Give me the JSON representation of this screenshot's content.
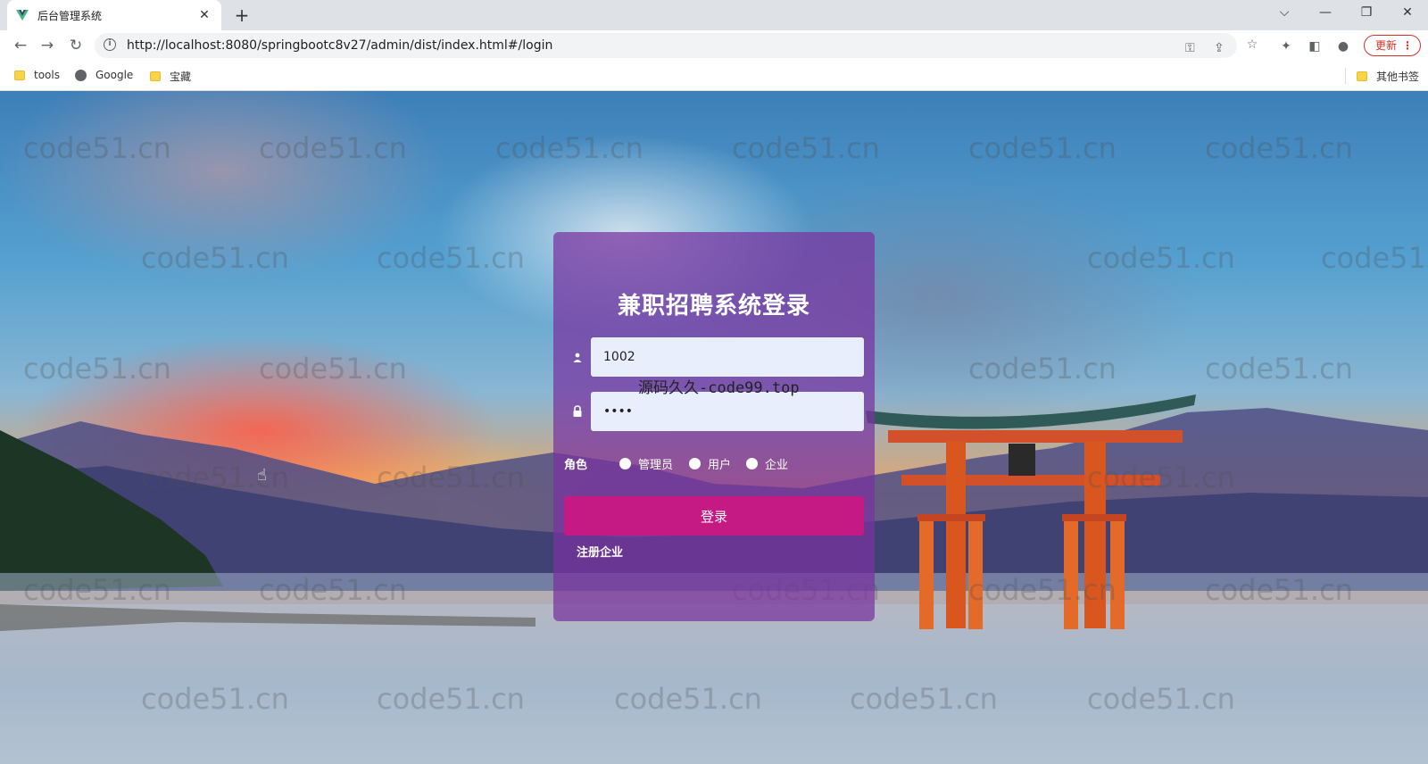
{
  "browser": {
    "tab_title": "后台管理系统",
    "tab_close": "✕",
    "new_tab": "+",
    "url": "http://localhost:8080/springbootc8v27/admin/dist/index.html#/login",
    "update_label": "更新",
    "window_controls": {
      "menu": "⌵",
      "minimize": "—",
      "restore": "❐",
      "close": "✕"
    }
  },
  "bookmarks": [
    {
      "label": "tools",
      "icon": "folder-icon"
    },
    {
      "label": "Google",
      "icon": "globe-icon"
    },
    {
      "label": "宝藏",
      "icon": "folder-icon"
    }
  ],
  "other_bookmarks": "其他书签",
  "login": {
    "title": "兼职招聘系统登录",
    "username_value": "1002",
    "password_value": "••••",
    "role_label": "角色",
    "roles": [
      "管理员",
      "用户",
      "企业"
    ],
    "login_button": "登录",
    "register_link": "注册企业"
  },
  "overlay_text": "源码久久-code99.top",
  "watermark_text": "code51.cn",
  "colors": {
    "login_button": "#c51a84",
    "panel": "#7832a0",
    "update_button": "#d93025"
  }
}
